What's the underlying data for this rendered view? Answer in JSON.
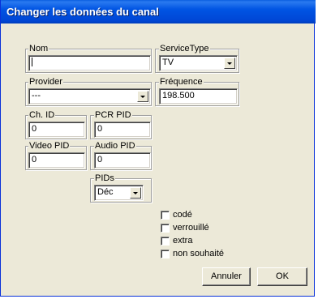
{
  "window": {
    "title": "Changer les données du canal"
  },
  "fields": {
    "nom": {
      "label": "Nom",
      "value": ""
    },
    "service_type": {
      "label": "ServiceType",
      "value": "TV"
    },
    "provider": {
      "label": "Provider",
      "value": "---"
    },
    "frequence": {
      "label": "Fréquence",
      "value": "198.500"
    },
    "ch_id": {
      "label": "Ch. ID",
      "value": "0"
    },
    "pcr_pid": {
      "label": "PCR PID",
      "value": "0"
    },
    "video_pid": {
      "label": "Video PID",
      "value": "0"
    },
    "audio_pid": {
      "label": "Audio PID",
      "value": "0"
    },
    "pids": {
      "label": "PIDs",
      "value": "Déc"
    }
  },
  "checkboxes": [
    {
      "label": "codé",
      "checked": false
    },
    {
      "label": "verrouillé",
      "checked": false
    },
    {
      "label": "extra",
      "checked": false
    },
    {
      "label": "non souhaité",
      "checked": false
    }
  ],
  "buttons": {
    "cancel": "Annuler",
    "ok": "OK"
  }
}
